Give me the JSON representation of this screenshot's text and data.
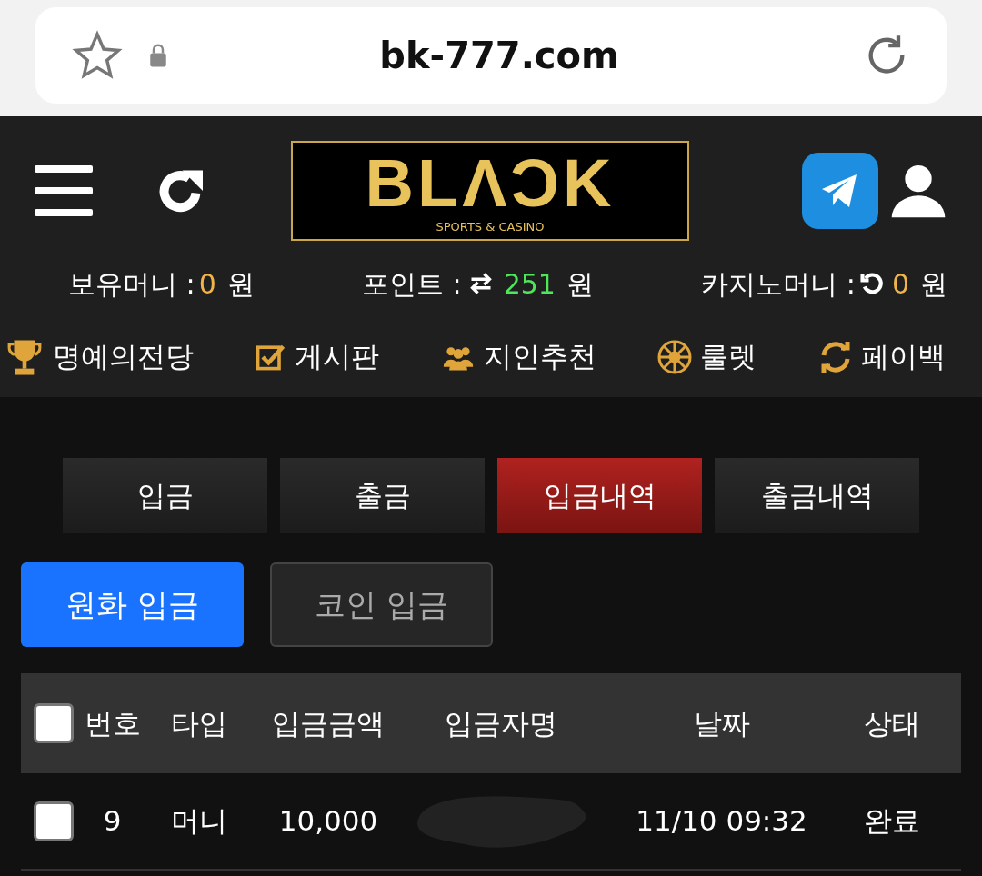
{
  "browser": {
    "url": "bk-777.com"
  },
  "logo": {
    "wordmark": "BLΛƆK",
    "tagline": "SPORTS & CASINO"
  },
  "balances": [
    {
      "kind": "money",
      "label": "보유머니 :",
      "value": "0",
      "unit": "원",
      "color": "#f0b44a"
    },
    {
      "kind": "points",
      "label": "포인트 :",
      "value": "251",
      "unit": "원",
      "color": "#4ee65a"
    },
    {
      "kind": "casino",
      "label": "카지노머니 :",
      "value": "0",
      "unit": "원",
      "color": "#f0b44a"
    }
  ],
  "menu": [
    {
      "kind": "trophy",
      "label": "명예의전당"
    },
    {
      "kind": "board",
      "label": "게시판"
    },
    {
      "kind": "people",
      "label": "지인추천"
    },
    {
      "kind": "wheel",
      "label": "룰렛"
    },
    {
      "kind": "cycle",
      "label": "페이백"
    }
  ],
  "tabs": [
    {
      "label": "입금",
      "selected": false
    },
    {
      "label": "출금",
      "selected": false
    },
    {
      "label": "입금내역",
      "selected": true
    },
    {
      "label": "출금내역",
      "selected": false
    }
  ],
  "sub_tabs": [
    {
      "label": "원화 입금",
      "selected": true
    },
    {
      "label": "코인 입금",
      "selected": false
    }
  ],
  "table": {
    "select_all": {
      "checked": false
    },
    "columns": [
      "번호",
      "타입",
      "입금금액",
      "입금자명",
      "날짜",
      "상태"
    ],
    "rows": [
      {
        "checked": false,
        "cells": [
          "9",
          "머니",
          "10,000",
          null,
          "11/10 09:32",
          "완료"
        ]
      }
    ]
  }
}
